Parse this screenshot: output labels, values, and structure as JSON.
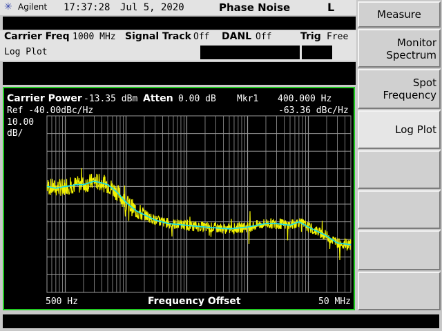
{
  "header": {
    "brand": "Agilent",
    "time": "17:37:28",
    "date": "Jul 5, 2020",
    "mode": "Phase Noise",
    "indicator": "L"
  },
  "settings": {
    "carrier_freq_label": "Carrier Freq",
    "carrier_freq_value": "1000 MHz",
    "signal_track_label": "Signal Track",
    "signal_track_value": "Off",
    "danl_label": "DANL",
    "danl_value": "Off",
    "trig_label": "Trig",
    "trig_value": "Free",
    "view": "Log Plot"
  },
  "plot": {
    "carrier_power_label": "Carrier Power",
    "carrier_power_value": "-13.35 dBm",
    "atten_label": "Atten",
    "atten_value": "0.00 dB",
    "marker_label": "Mkr1",
    "marker_freq": "400.000  Hz",
    "ref_label": "Ref -40.00dBc/Hz",
    "marker_value": "-63.36 dBc/Hz",
    "scale_value": "10.00",
    "scale_unit": "dB/",
    "x_start": "500 Hz",
    "x_label": "Frequency Offset",
    "x_stop": "50 MHz"
  },
  "softkeys": {
    "title": "Measure",
    "monitor_line1": "Monitor",
    "monitor_line2": "Spectrum",
    "spot_line1": "Spot",
    "spot_line2": "Frequency",
    "log_plot": "Log Plot"
  },
  "colors": {
    "trace": "#f2f200",
    "smoothed_trace": "#22dddd",
    "frame": "#22cc22",
    "grid": "#9a9a9a"
  },
  "chart_data": {
    "type": "line",
    "x_scale": "log",
    "xlim_hz": [
      500,
      50000000
    ],
    "ylim_dbc_hz": [
      -140,
      -40
    ],
    "y_per_div_db": 10,
    "grid": true,
    "series": [
      {
        "x_hz": [
          500,
          700,
          1000,
          1500,
          2000,
          3000,
          4000,
          5000,
          7000,
          10000,
          15000,
          20000,
          30000,
          50000,
          100000,
          200000,
          500000,
          1000000,
          2000000,
          3000000,
          5000000,
          7000000,
          10000000,
          20000000,
          30000000,
          50000000
        ],
        "y_dbc_hz": [
          -80,
          -81,
          -80,
          -79,
          -79,
          -77,
          -78,
          -79,
          -83,
          -89,
          -94,
          -96,
          -99,
          -101,
          -102,
          -103,
          -104,
          -103,
          -101,
          -101,
          -102,
          -100,
          -103,
          -108,
          -112,
          -113
        ]
      }
    ]
  }
}
